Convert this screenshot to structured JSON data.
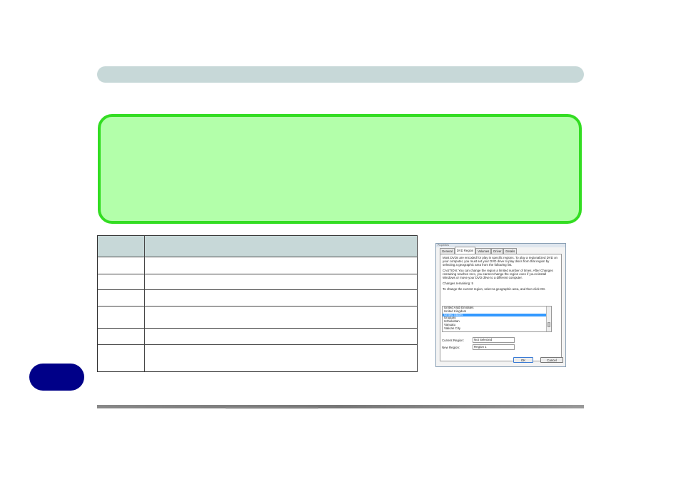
{
  "dialog": {
    "title": "Properties",
    "tabs": [
      "General",
      "DVD Region",
      "Volumes",
      "Driver",
      "Details"
    ],
    "description": "Most DVDs are encoded for play in specific regions. To play a regionalized DVD on your computer, you must set your DVD drive to play discs from that region by selecting a geographic area from the following list.",
    "caution": "CAUTION: You can change the region a limited number of times. After Changes remaining reaches zero, you cannot change the region even if you reinstall Windows or move your DVD drive to a different computer.",
    "changes_remaining": "Changes remaining: 5",
    "instruction": "To change the current region, select a geographic area, and then click OK.",
    "regions": [
      "United Arab Emirates",
      "United Kingdom",
      "United States",
      "Uruguay",
      "Uzbekistan",
      "Vanuatu",
      "Vatican City"
    ],
    "selected_region": "United States",
    "current_region_label": "Current Region:",
    "current_region_value": "Not Selected",
    "new_region_label": "New Region:",
    "new_region_value": "Region 1",
    "ok_label": "OK",
    "cancel_label": "Cancel"
  },
  "colors": {
    "header_bar": "#c7d8d8",
    "note_fill": "#b3ffaa",
    "note_border": "#33dd22",
    "badge": "#000088"
  }
}
